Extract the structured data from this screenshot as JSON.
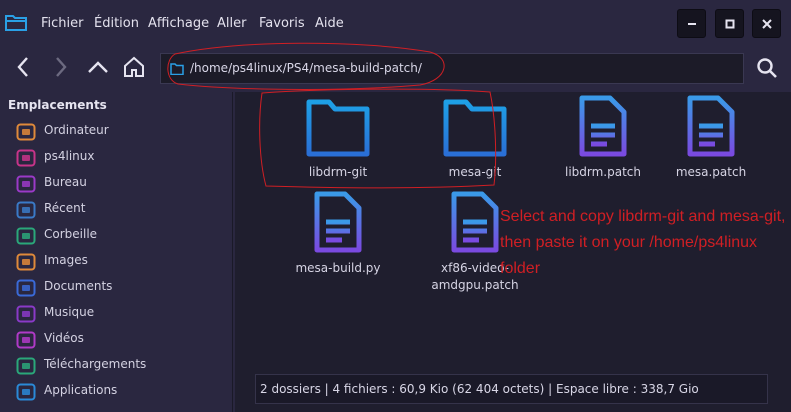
{
  "menu": {
    "items": [
      "Fichier",
      "Édition",
      "Affichage",
      "Aller",
      "Favoris",
      "Aide"
    ]
  },
  "window_controls": {
    "minimize": "minimize",
    "maximize": "maximize",
    "close": "close"
  },
  "toolbar": {
    "path": "/home/ps4linux/PS4/mesa-build-patch/"
  },
  "sidebar": {
    "header": "Emplacements",
    "items": [
      {
        "label": "Ordinateur",
        "icon": "computer-icon",
        "color": "#e08a3a"
      },
      {
        "label": "ps4linux",
        "icon": "home-icon",
        "color": "#c8348a"
      },
      {
        "label": "Bureau",
        "icon": "desktop-icon",
        "color": "#9b3ac8"
      },
      {
        "label": "Récent",
        "icon": "recent-icon",
        "color": "#3a7ac8"
      },
      {
        "label": "Corbeille",
        "icon": "trash-icon",
        "color": "#2aa87a"
      },
      {
        "label": "Images",
        "icon": "images-icon",
        "color": "#e08a3a"
      },
      {
        "label": "Documents",
        "icon": "documents-icon",
        "color": "#3a6ad8"
      },
      {
        "label": "Musique",
        "icon": "music-icon",
        "color": "#8a3ac8"
      },
      {
        "label": "Vidéos",
        "icon": "videos-icon",
        "color": "#b03ac8"
      },
      {
        "label": "Téléchargements",
        "icon": "downloads-icon",
        "color": "#2aa87a"
      },
      {
        "label": "Applications",
        "icon": "applications-icon",
        "color": "#2a8ad8"
      }
    ]
  },
  "files": [
    {
      "name": "libdrm-git",
      "type": "folder"
    },
    {
      "name": "mesa-git",
      "type": "folder"
    },
    {
      "name": "libdrm.patch",
      "type": "document"
    },
    {
      "name": "mesa.patch",
      "type": "document"
    },
    {
      "name": "mesa-build.py",
      "type": "document"
    },
    {
      "name": "xf86-video-amdgpu.patch",
      "type": "document",
      "label_lines": [
        "xf86-video-",
        "amdgpu.patch"
      ]
    }
  ],
  "annotation": {
    "text": "Select and copy libdrm-git and mesa-git, then paste it on your /home/ps4linux folder",
    "color": "#d01f24"
  },
  "status": {
    "text": "2 dossiers  |  4 fichiers : 60,9 Kio (62 404 octets)  |  Espace libre : 338,7 Gio"
  },
  "colors": {
    "background": "#2a2740",
    "content_background": "#1f1e2e",
    "folder_gradient": [
      "#1ea0e6",
      "#2a6fd6"
    ],
    "doc_gradient": [
      "#3a9ae8",
      "#7a4ae0"
    ]
  }
}
